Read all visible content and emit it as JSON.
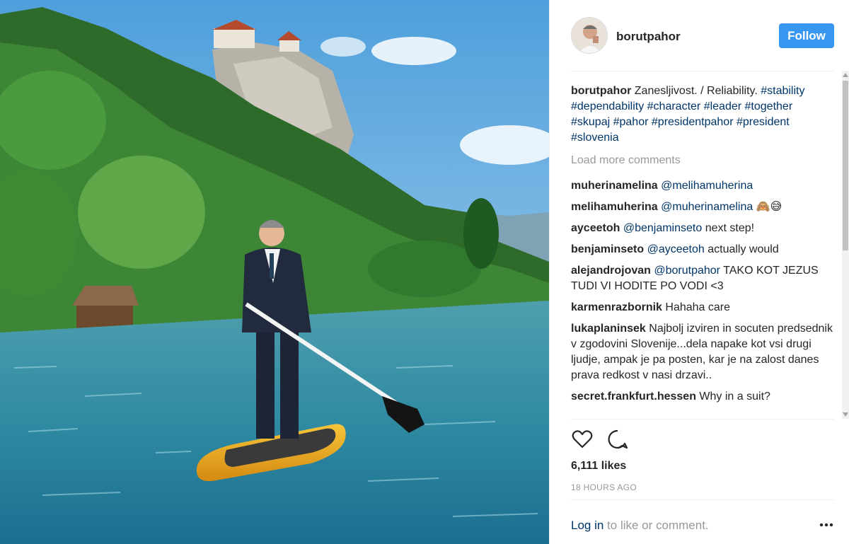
{
  "post": {
    "username": "borutpahor",
    "follow_label": "Follow",
    "caption": {
      "author": "borutpahor",
      "text": "Zanesljivost. / Reliability.",
      "hashtags": [
        "#stability",
        "#dependability",
        "#character",
        "#leader",
        "#together",
        "#skupaj",
        "#pahor",
        "#presidentpahor",
        "#president",
        "#slovenia"
      ]
    },
    "load_more": "Load more comments",
    "comments": [
      {
        "author": "muherinamelina",
        "mention": "@melihamuherina",
        "text": "",
        "emoji": ""
      },
      {
        "author": "melihamuherina",
        "mention": "@muherinamelina",
        "text": "",
        "emoji": "🙈😅"
      },
      {
        "author": "ayceetoh",
        "mention": "@benjaminseto",
        "text": "next step!",
        "emoji": ""
      },
      {
        "author": "benjaminseto",
        "mention": "@ayceetoh",
        "text": "actually would",
        "emoji": ""
      },
      {
        "author": "alejandrojovan",
        "mention": "@borutpahor",
        "text": "TAKO KOT JEZUS TUDI VI HODITE PO VODI <3",
        "emoji": ""
      },
      {
        "author": "karmenrazbornik",
        "mention": "",
        "text": "Hahaha care",
        "emoji": ""
      },
      {
        "author": "lukaplaninsek",
        "mention": "",
        "text": "Najbolj izviren in socuten predsednik v zgodovini Slovenije...dela napake kot vsi drugi ljudje, ampak je pa posten, kar je na zalost danes prava redkost v nasi drzavi..",
        "emoji": ""
      },
      {
        "author": "secret.frankfurt.hessen",
        "mention": "",
        "text": "Why in a suit?",
        "emoji": ""
      }
    ],
    "likes": "6,111 likes",
    "time_ago": "18 HOURS AGO",
    "login_link": "Log in",
    "login_text": " to like or comment."
  },
  "icons": {
    "like": "heart-icon",
    "comment": "speech-bubble-icon",
    "more": "ellipsis-icon"
  },
  "colors": {
    "follow_bg": "#3897f0",
    "link": "#003569",
    "muted": "#999999",
    "text": "#262626"
  }
}
